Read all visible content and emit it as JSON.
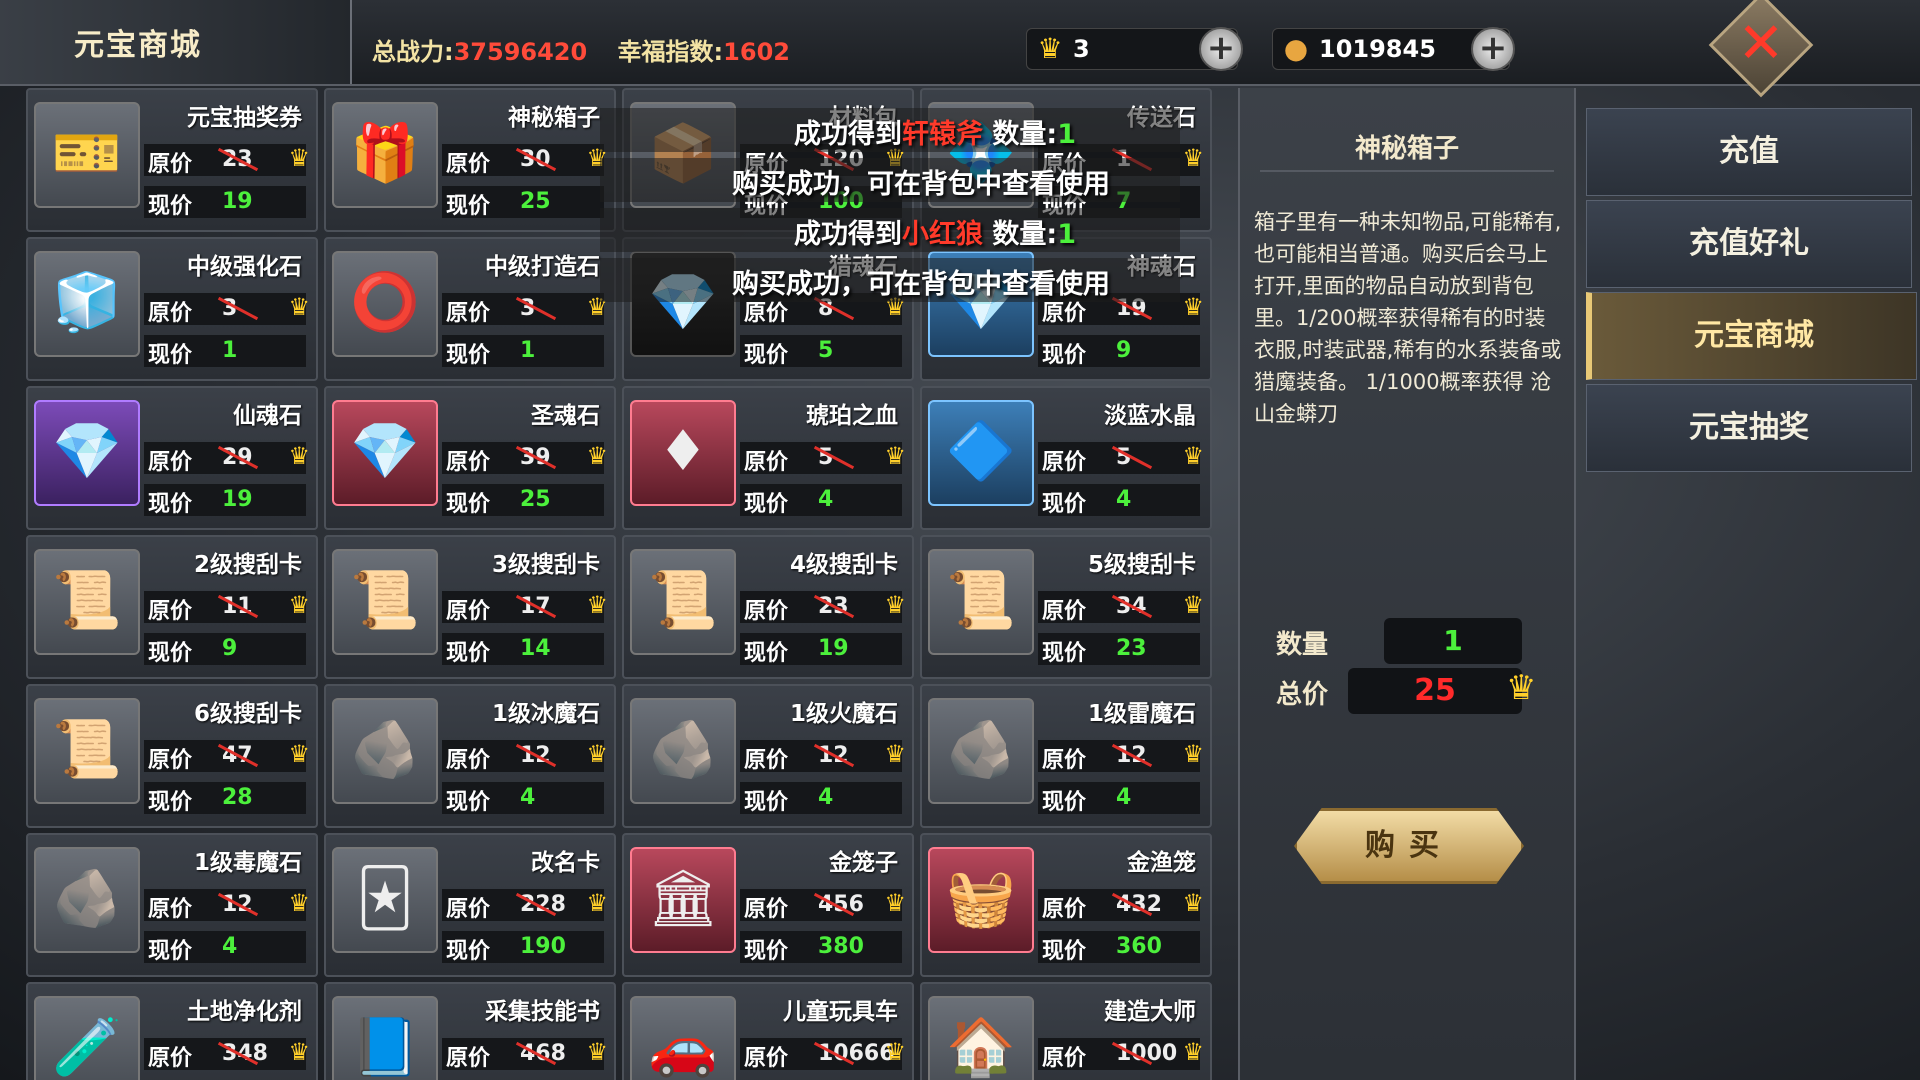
{
  "header": {
    "title": "元宝商城",
    "power_label": "总战力:",
    "power_value": "37596420",
    "luck_label": "幸福指数:",
    "luck_value": "1602",
    "ingot_count": "3",
    "coin_count": "1019845"
  },
  "nav": [
    {
      "label": "充值"
    },
    {
      "label": "充值好礼"
    },
    {
      "label": "元宝商城"
    },
    {
      "label": "元宝抽奖"
    }
  ],
  "labels": {
    "orig": "原价",
    "now": "现价"
  },
  "items": [
    {
      "name": "元宝抽奖券",
      "orig": "23",
      "now": "19",
      "icon": "ticket-icon",
      "glyph": "🎫",
      "style": ""
    },
    {
      "name": "神秘箱子",
      "orig": "30",
      "now": "25",
      "icon": "gift-box-icon",
      "glyph": "🎁",
      "style": ""
    },
    {
      "name": "材料包",
      "orig": "120",
      "now": "100",
      "icon": "material-pack-icon",
      "glyph": "📦",
      "style": ""
    },
    {
      "name": "传送石",
      "orig": "1",
      "now": "7",
      "icon": "teleport-stone-icon",
      "glyph": "💠",
      "style": ""
    },
    {
      "name": "中级强化石",
      "orig": "3",
      "now": "1",
      "icon": "cube-icon",
      "glyph": "🧊",
      "style": ""
    },
    {
      "name": "中级打造石",
      "orig": "3",
      "now": "1",
      "icon": "ring-icon",
      "glyph": "⭕",
      "style": ""
    },
    {
      "name": "猎魂石",
      "orig": "8",
      "now": "5",
      "icon": "yellow-crystal-icon",
      "glyph": "💎",
      "style": "dark"
    },
    {
      "name": "神魂石",
      "orig": "19",
      "now": "9",
      "icon": "green-crystal-icon",
      "glyph": "💎",
      "style": "blue"
    },
    {
      "name": "仙魂石",
      "orig": "29",
      "now": "19",
      "icon": "blue-crystal-icon",
      "glyph": "💎",
      "style": "purple"
    },
    {
      "name": "圣魂石",
      "orig": "39",
      "now": "25",
      "icon": "red-crystal-icon",
      "glyph": "💎",
      "style": "red"
    },
    {
      "name": "琥珀之血",
      "orig": "5",
      "now": "4",
      "icon": "ruby-icon",
      "glyph": "♦",
      "style": "red"
    },
    {
      "name": "淡蓝水晶",
      "orig": "5",
      "now": "4",
      "icon": "blue-gem-icon",
      "glyph": "🔷",
      "style": "blue"
    },
    {
      "name": "2级搜刮卡",
      "orig": "11",
      "now": "9",
      "icon": "scroll-icon",
      "glyph": "📜",
      "style": ""
    },
    {
      "name": "3级搜刮卡",
      "orig": "17",
      "now": "14",
      "icon": "scroll-icon",
      "glyph": "📜",
      "style": ""
    },
    {
      "name": "4级搜刮卡",
      "orig": "23",
      "now": "19",
      "icon": "scroll-icon",
      "glyph": "📜",
      "style": ""
    },
    {
      "name": "5级搜刮卡",
      "orig": "34",
      "now": "23",
      "icon": "scroll-icon",
      "glyph": "📜",
      "style": ""
    },
    {
      "name": "6级搜刮卡",
      "orig": "47",
      "now": "28",
      "icon": "scroll-icon",
      "glyph": "📜",
      "style": ""
    },
    {
      "name": "1级冰魔石",
      "orig": "12",
      "now": "4",
      "icon": "ice-stone-icon",
      "glyph": "🪨",
      "style": ""
    },
    {
      "name": "1级火魔石",
      "orig": "12",
      "now": "4",
      "icon": "fire-stone-icon",
      "glyph": "🪨",
      "style": ""
    },
    {
      "name": "1级雷魔石",
      "orig": "12",
      "now": "4",
      "icon": "thunder-stone-icon",
      "glyph": "🪨",
      "style": ""
    },
    {
      "name": "1级毒魔石",
      "orig": "12",
      "now": "4",
      "icon": "poison-stone-icon",
      "glyph": "🪨",
      "style": ""
    },
    {
      "name": "改名卡",
      "orig": "228",
      "now": "190",
      "icon": "rename-card-icon",
      "glyph": "🃏",
      "style": ""
    },
    {
      "name": "金笼子",
      "orig": "456",
      "now": "380",
      "icon": "cage-icon",
      "glyph": "🏛",
      "style": "red"
    },
    {
      "name": "金渔笼",
      "orig": "432",
      "now": "360",
      "icon": "fish-trap-icon",
      "glyph": "🧺",
      "style": "red"
    },
    {
      "name": "土地净化剂",
      "orig": "348",
      "now": "",
      "icon": "potion-icon",
      "glyph": "🧪",
      "style": ""
    },
    {
      "name": "采集技能书",
      "orig": "468",
      "now": "",
      "icon": "book-icon",
      "glyph": "📘",
      "style": ""
    },
    {
      "name": "儿童玩具车",
      "orig": "10666",
      "now": "",
      "icon": "toy-car-icon",
      "glyph": "🚗",
      "style": ""
    },
    {
      "name": "建造大师",
      "orig": "1000",
      "now": "",
      "icon": "building-icon",
      "glyph": "🏠",
      "style": ""
    }
  ],
  "detail": {
    "title": "神秘箱子",
    "description": "箱子里有一种未知物品,可能稀有,也可能相当普通。购买后会马上打开,里面的物品自动放到背包里。1/200概率获得稀有的时装衣服,时装武器,稀有的水系装备或猎魔装备。 1/1000概率获得 沧山金蟒刀",
    "qty_label": "数量",
    "qty_value": "1",
    "total_label": "总价",
    "total_value": "25",
    "buy_label": "购买"
  },
  "toasts": [
    {
      "pre": "成功得到",
      "item": "轩辕斧",
      "mid": " 数量:",
      "count": "1"
    },
    {
      "text": "购买成功，可在背包中查看使用"
    },
    {
      "pre": "成功得到",
      "item": "小红狼",
      "mid": " 数量:",
      "count": "1"
    },
    {
      "text": "购买成功，可在背包中查看使用"
    }
  ]
}
